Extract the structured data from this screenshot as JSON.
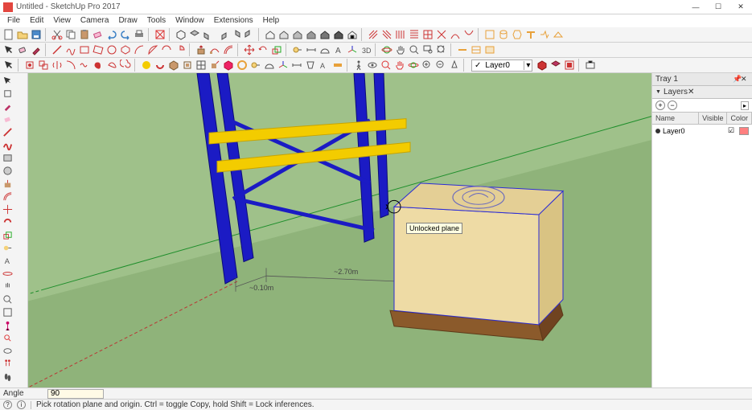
{
  "window": {
    "title": "Untitled - SketchUp Pro 2017"
  },
  "win_buttons": {
    "min": "—",
    "max": "☐",
    "close": "✕"
  },
  "menus": [
    "File",
    "Edit",
    "View",
    "Camera",
    "Draw",
    "Tools",
    "Window",
    "Extensions",
    "Help"
  ],
  "layer_combo": {
    "checked": "✓",
    "value": "Layer0",
    "arrow": "▾"
  },
  "tray": {
    "title": "Tray 1",
    "panel": "Layers",
    "columns": {
      "name": "Name",
      "visible": "Visible",
      "color": "Color"
    },
    "row": {
      "name": "Layer0",
      "color": "#ff8080"
    }
  },
  "vcb": {
    "label": "Angle",
    "value": "90"
  },
  "status": {
    "tip": "Pick rotation plane and origin. Ctrl = toggle Copy, hold Shift = Lock inferences."
  },
  "viewport": {
    "tooltip": "Unlocked plane",
    "dim1": "~0.10m",
    "dim2": "~2.70m"
  },
  "chart_data": {
    "type": "3d-scene",
    "note": "SketchUp modeling viewport, not a data chart",
    "objects": [
      {
        "name": "rack",
        "color_posts": "#1b1bc4",
        "color_beams": "#f3cc00",
        "posts": 4,
        "beam_levels": 2
      },
      {
        "name": "box-on-pallet",
        "box_color": "#eedba5",
        "pallet_color": "#8b5a2b",
        "has_circle_logo": true
      }
    ],
    "ground_color": "#8fb37a",
    "axes": [
      "red",
      "green",
      "blue"
    ],
    "dimensions_shown": [
      {
        "label": "~0.10m"
      },
      {
        "label": "~2.70m"
      }
    ]
  }
}
